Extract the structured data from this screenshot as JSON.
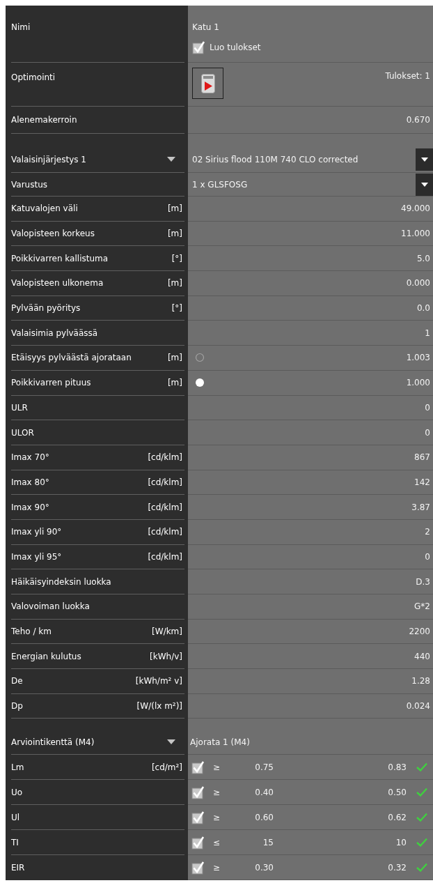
{
  "name": {
    "label": "Nimi",
    "value": "Katu 1",
    "create_results": {
      "label": "Luo tulokset",
      "checked": true
    }
  },
  "optimization": {
    "label": "Optimointi",
    "results": "Tulokset: 1"
  },
  "reduction": {
    "label": "Alenemakerroin",
    "value": "0.670"
  },
  "luminaire": {
    "label": "Valaisinjärjestys 1",
    "value": "02 Sirius flood 110M 740 CLO corrected",
    "rows": [
      {
        "kind": "select",
        "label": "Varustus",
        "value": "1 x GLSFOSG"
      },
      {
        "kind": "value",
        "label": "Katuvalojen väli",
        "unit": "[m]",
        "value": "49.000"
      },
      {
        "kind": "value",
        "label": "Valopisteen korkeus",
        "unit": "[m]",
        "value": "11.000"
      },
      {
        "kind": "value",
        "label": "Poikkivarren kallistuma",
        "unit": "[°]",
        "value": "5.0"
      },
      {
        "kind": "value",
        "label": "Valopisteen ulkonema",
        "unit": "[m]",
        "value": "0.000"
      },
      {
        "kind": "value",
        "label": "Pylvään pyöritys",
        "unit": "[°]",
        "value": "0.0"
      },
      {
        "kind": "value",
        "label": "Valaisimia pylväässä",
        "value": "1"
      },
      {
        "kind": "radio",
        "label": "Etäisyys pylväästä ajorataan",
        "unit": "[m]",
        "value": "1.003",
        "selected": false
      },
      {
        "kind": "radio",
        "label": "Poikkivarren pituus",
        "unit": "[m]",
        "value": "1.000",
        "selected": true
      },
      {
        "kind": "value",
        "label": "ULR",
        "value": "0"
      },
      {
        "kind": "value",
        "label": "ULOR",
        "value": "0"
      },
      {
        "kind": "value",
        "label": "Imax 70°",
        "unit": "[cd/klm]",
        "value": "867"
      },
      {
        "kind": "value",
        "label": "Imax 80°",
        "unit": "[cd/klm]",
        "value": "142"
      },
      {
        "kind": "value",
        "label": "Imax 90°",
        "unit": "[cd/klm]",
        "value": "3.87"
      },
      {
        "kind": "value",
        "label": "Imax yli 90°",
        "unit": "[cd/klm]",
        "value": "2"
      },
      {
        "kind": "value",
        "label": "Imax yli 95°",
        "unit": "[cd/klm]",
        "value": "0"
      },
      {
        "kind": "value",
        "label": "Häikäisyindeksin luokka",
        "value": "D.3"
      },
      {
        "kind": "value",
        "label": "Valovoiman luokka",
        "value": "G*2"
      },
      {
        "kind": "value",
        "label": "Teho / km",
        "unit": "[W/km]",
        "value": "2200"
      },
      {
        "kind": "value",
        "label": "Energian kulutus",
        "unit": "[kWh/v]",
        "value": "440"
      },
      {
        "kind": "value",
        "label": "De",
        "unit": "[kWh/m² v]",
        "value": "1.28"
      },
      {
        "kind": "value",
        "label": "Dp",
        "unit": "[W/(lx m²)]",
        "value": "0.024"
      }
    ]
  },
  "evaluation": {
    "label": "Arviointikenttä (M4)",
    "value": "Ajorata 1 (M4)",
    "criteria": [
      {
        "label": "Lm",
        "unit": "[cd/m²]",
        "checked": true,
        "operator": "≥",
        "limit": "0.75",
        "result": "0.83",
        "passed": true
      },
      {
        "label": "Uo",
        "checked": true,
        "operator": "≥",
        "limit": "0.40",
        "result": "0.50",
        "passed": true
      },
      {
        "label": "Ul",
        "checked": true,
        "operator": "≥",
        "limit": "0.60",
        "result": "0.62",
        "passed": true
      },
      {
        "label": "TI",
        "checked": true,
        "operator": "≤",
        "limit": "15",
        "result": "10",
        "passed": true
      },
      {
        "label": "EIR",
        "checked": true,
        "operator": "≥",
        "limit": "0.30",
        "result": "0.32",
        "passed": true
      }
    ]
  }
}
